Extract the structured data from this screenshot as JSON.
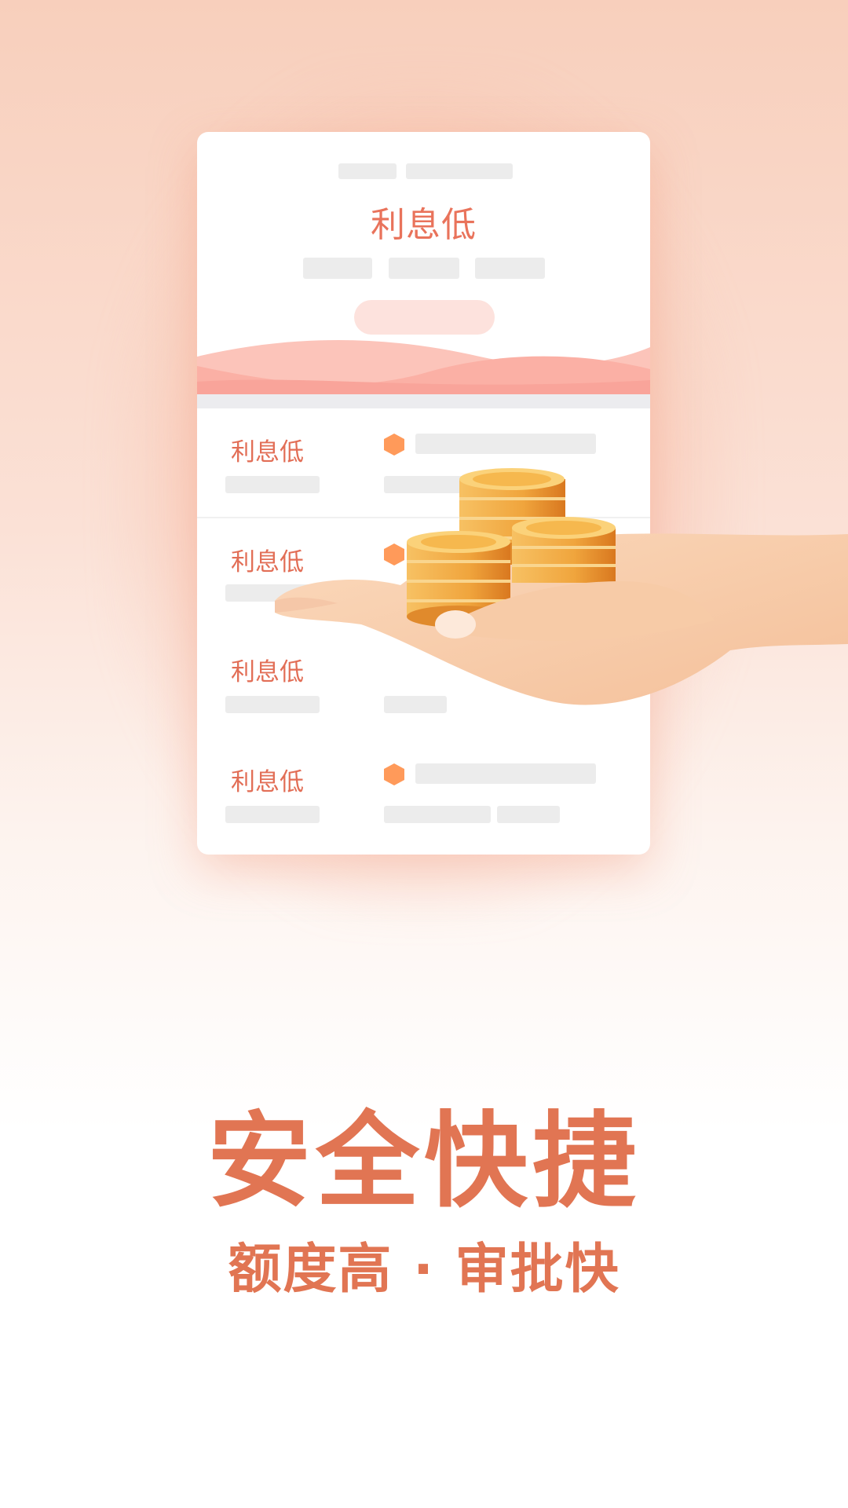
{
  "card": {
    "title": "利息低",
    "rows": [
      {
        "label": "利息低"
      },
      {
        "label": "利息低"
      },
      {
        "label": "利息低"
      },
      {
        "label": "利息低"
      }
    ]
  },
  "headline": "安全快捷",
  "subline": "额度高 · 审批快",
  "icons": [
    "hexagon-bullet-icon",
    "coins-illustration",
    "hand-illustration"
  ],
  "colors": {
    "accent": "#e17553",
    "label": "#e26e56",
    "hex": "#ff9a5a",
    "placeholder": "#ececec",
    "wave": "#fbb3a8"
  }
}
